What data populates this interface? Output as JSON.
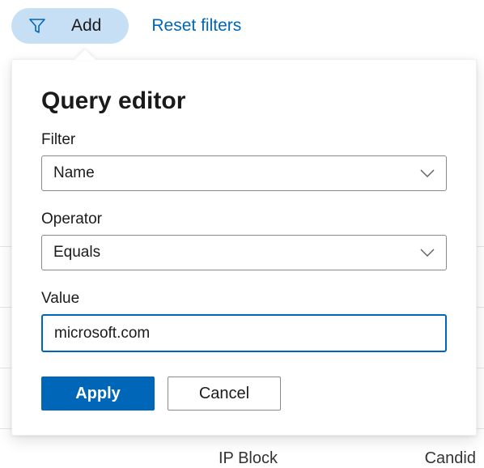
{
  "topbar": {
    "add_label": "Add",
    "reset_label": "Reset filters"
  },
  "editor": {
    "title": "Query editor",
    "filter_label": "Filter",
    "filter_value": "Name",
    "operator_label": "Operator",
    "operator_value": "Equals",
    "value_label": "Value",
    "value_input": "microsoft.com",
    "apply_label": "Apply",
    "cancel_label": "Cancel"
  },
  "background": {
    "col1": "IP Block",
    "col2": "Candid"
  }
}
